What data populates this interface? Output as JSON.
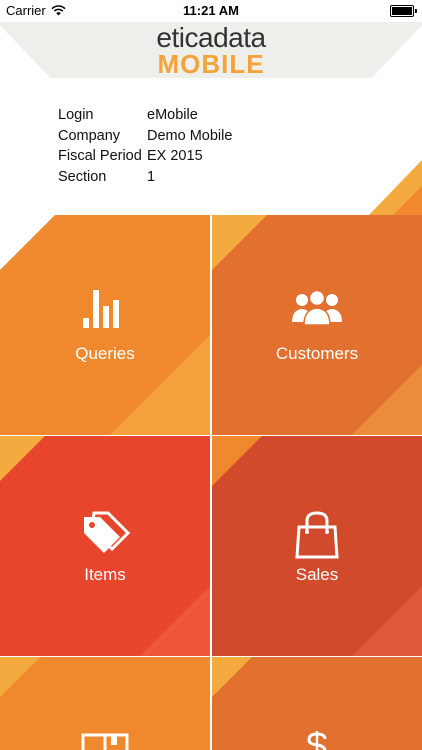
{
  "status_bar": {
    "carrier": "Carrier",
    "time": "11:21 AM"
  },
  "logo": {
    "line1": "eticadata",
    "line2": "MOBILE"
  },
  "info": [
    {
      "label": "Login",
      "value": "eMobile"
    },
    {
      "label": "Company",
      "value": "Demo Mobile"
    },
    {
      "label": "Fiscal Period",
      "value": "EX 2015"
    },
    {
      "label": "Section",
      "value": "1"
    }
  ],
  "tiles": [
    {
      "label": "Queries",
      "icon": "bar-chart-icon",
      "color": "#f0892e"
    },
    {
      "label": "Customers",
      "icon": "users-icon",
      "color": "#e2702e"
    },
    {
      "label": "Items",
      "icon": "tags-icon",
      "color": "#e8462c"
    },
    {
      "label": "Sales",
      "icon": "shopping-bag-icon",
      "color": "#d24a2c"
    },
    {
      "label": "",
      "icon": "book-icon",
      "color": "#f0892e"
    },
    {
      "label": "",
      "icon": "dollar-icon",
      "color": "#e2702e"
    }
  ],
  "colors": {
    "accent_light": "#f5aa40",
    "accent_orange": "#f0892e"
  }
}
